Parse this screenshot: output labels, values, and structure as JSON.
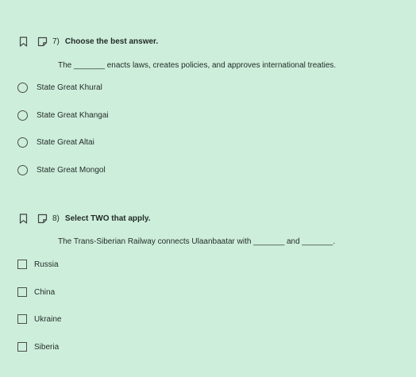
{
  "questions": [
    {
      "number": "7)",
      "instruction": "Choose the best answer.",
      "stem": "The _______ enacts laws, creates policies, and approves international treaties.",
      "type": "single",
      "options": [
        {
          "label": "State Great Khural"
        },
        {
          "label": "State Great Khangai"
        },
        {
          "label": "State Great Altai"
        },
        {
          "label": "State Great Mongol"
        }
      ]
    },
    {
      "number": "8)",
      "instruction": "Select TWO that apply.",
      "stem": "The Trans-Siberian Railway connects Ulaanbaatar with _______ and _______.",
      "type": "multiple",
      "options": [
        {
          "label": "Russia"
        },
        {
          "label": "China"
        },
        {
          "label": "Ukraine"
        },
        {
          "label": "Siberia"
        }
      ]
    }
  ],
  "icons": {
    "bookmark": "bookmark-icon",
    "note": "note-icon"
  },
  "colors": {
    "background": "#ceeedc",
    "text": "#1f2a24",
    "control_border": "#4a4f4c"
  }
}
